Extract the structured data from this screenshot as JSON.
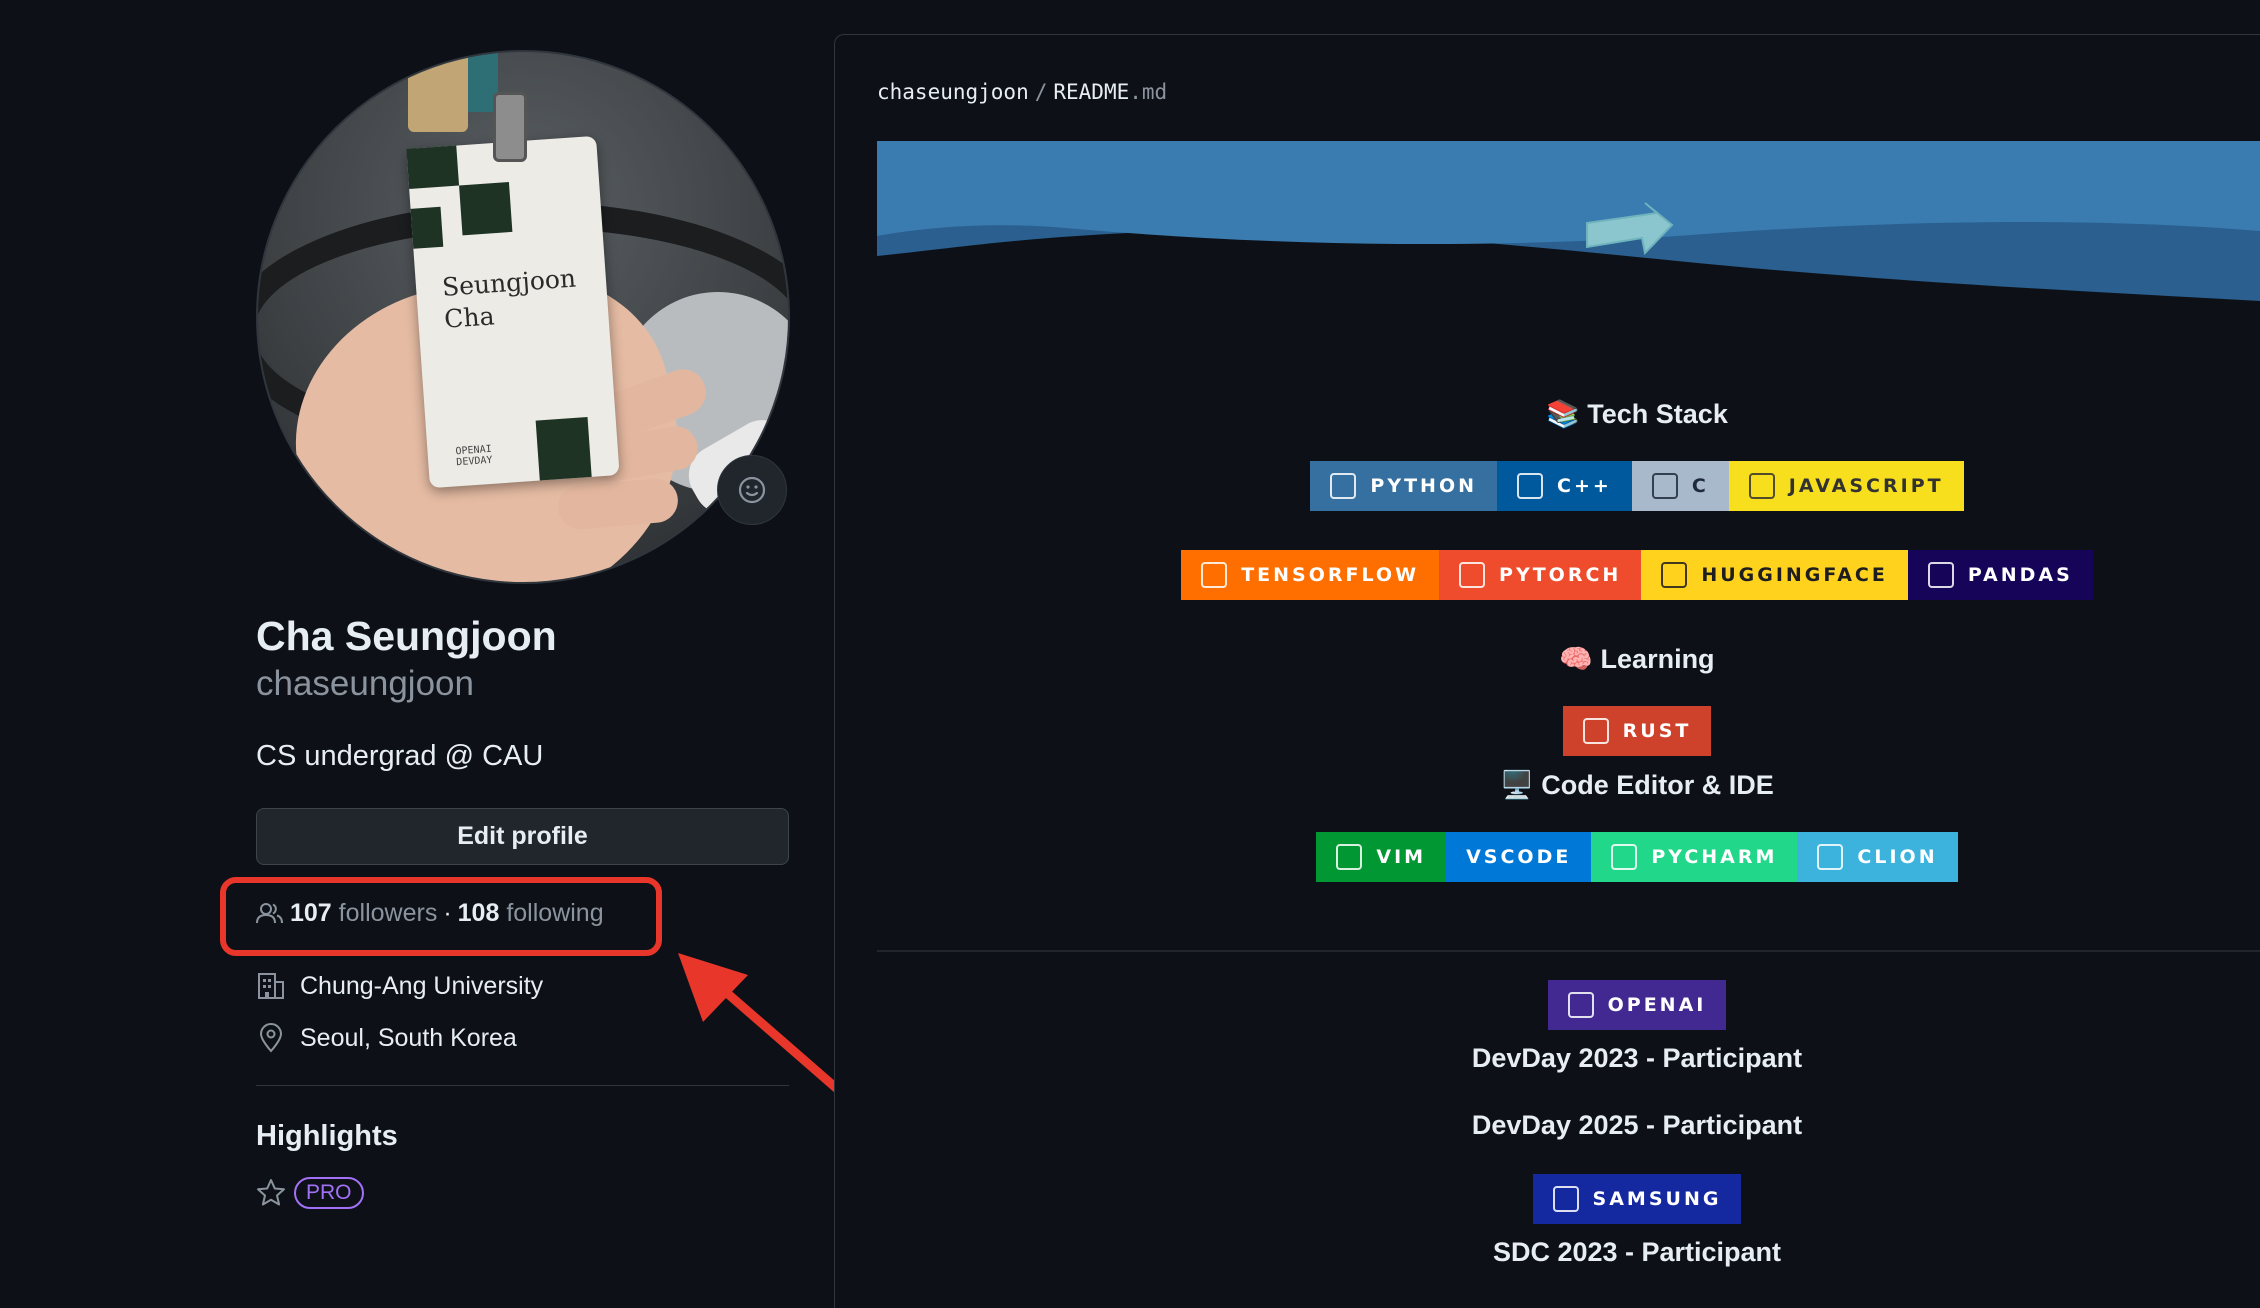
{
  "profile": {
    "card_name": "Seungjoon\nCha",
    "card_event": "OPENAI\nDEVDAY",
    "full_name": "Cha Seungjoon",
    "login": "chaseungjoon",
    "bio": "CS undergrad @ CAU",
    "edit_profile": "Edit profile",
    "followers_count": "107",
    "followers_label": "followers",
    "separator": "·",
    "following_count": "108",
    "following_label": "following",
    "organization": "Chung-Ang University",
    "location": "Seoul, South Korea",
    "highlights_title": "Highlights",
    "pro_badge": "PRO"
  },
  "readme": {
    "user": "chaseungjoon",
    "sep": "/",
    "file": "README",
    "ext": ".md",
    "tech_stack_title": "📚 Tech Stack",
    "learning_title": "🧠 Learning",
    "editor_title": "🖥️ Code Editor & IDE",
    "badges_row1": [
      {
        "label": "PYTHON",
        "bg": "#3670a0",
        "fg": "#ffffff",
        "icon": "python-icon"
      },
      {
        "label": "C++",
        "bg": "#00599c",
        "fg": "#ffffff",
        "icon": "cplusplus-icon"
      },
      {
        "label": "C",
        "bg": "#a8b9cc",
        "fg": "#1e2a3a",
        "icon": "c-icon"
      },
      {
        "label": "JAVASCRIPT",
        "bg": "#f7df1e",
        "fg": "#323330",
        "icon": "javascript-icon"
      }
    ],
    "badges_row2": [
      {
        "label": "TENSORFLOW",
        "bg": "#ff6f00",
        "fg": "#ffffff",
        "icon": "tensorflow-icon"
      },
      {
        "label": "PYTORCH",
        "bg": "#ee4c2c",
        "fg": "#ffffff",
        "icon": "pytorch-icon"
      },
      {
        "label": "HUGGINGFACE",
        "bg": "#ffd21e",
        "fg": "#1e1e1e",
        "icon": "huggingface-icon"
      },
      {
        "label": "PANDAS",
        "bg": "#150458",
        "fg": "#ffffff",
        "icon": "pandas-icon"
      }
    ],
    "badges_learning": [
      {
        "label": "RUST",
        "bg": "#ce422b",
        "fg": "#ffffff",
        "icon": "rust-icon"
      }
    ],
    "badges_editor": [
      {
        "label": "VIM",
        "bg": "#019733",
        "fg": "#ffffff",
        "icon": "vim-icon"
      },
      {
        "label": "VSCODE",
        "bg": "#0078d7",
        "fg": "#ffffff",
        "icon": ""
      },
      {
        "label": "PYCHARM",
        "bg": "#21d789",
        "fg": "#ffffff",
        "icon": "pycharm-icon"
      },
      {
        "label": "CLION",
        "bg": "#3bb3dd",
        "fg": "#ffffff",
        "icon": "clion-icon"
      }
    ],
    "openai_badge": {
      "label": "OPENAI",
      "bg": "#412991",
      "fg": "#ffffff",
      "icon": "openai-icon"
    },
    "devday_2023": "DevDay 2023 - Participant",
    "devday_2025": "DevDay 2025 - Participant",
    "samsung_badge": {
      "label": "SAMSUNG",
      "bg": "#1428a0",
      "fg": "#ffffff",
      "icon": "samsung-icon"
    },
    "sdc_2023": "SDC 2023 - Participant"
  },
  "annotation": {
    "box_color": "#e8362a"
  }
}
